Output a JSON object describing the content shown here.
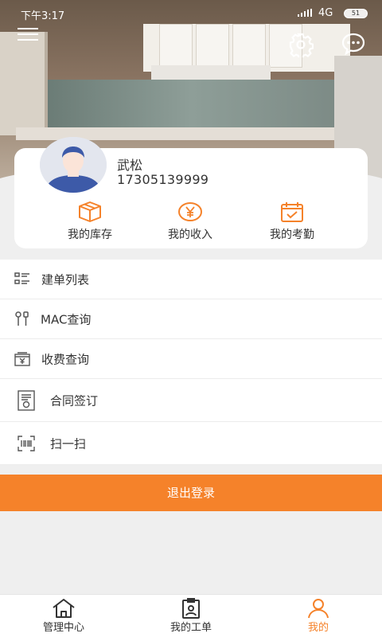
{
  "status_bar": {
    "time": "下午3:17",
    "network": "4G",
    "battery": "51"
  },
  "header": {
    "menu_icon": "menu-icon",
    "settings_icon": "gear-icon",
    "message_icon": "chat-bubble-icon"
  },
  "profile": {
    "name": "武松",
    "phone": "17305139999",
    "quick_links": [
      {
        "label": "我的库存",
        "icon": "box-icon"
      },
      {
        "label": "我的收入",
        "icon": "yen-coin-icon"
      },
      {
        "label": "我的考勤",
        "icon": "calendar-check-icon"
      }
    ]
  },
  "menu_items": [
    {
      "label": "建单列表",
      "icon": "list-icon"
    },
    {
      "label": "MAC查询",
      "icon": "tools-icon"
    },
    {
      "label": "收费查询",
      "icon": "fee-box-icon"
    },
    {
      "label": "合同签订",
      "icon": "contract-icon"
    },
    {
      "label": "扫一扫",
      "icon": "barcode-scan-icon"
    }
  ],
  "logout_label": "退出登录",
  "tabs": [
    {
      "label": "管理中心",
      "icon": "home-icon",
      "active": false
    },
    {
      "label": "我的工单",
      "icon": "work-order-icon",
      "active": false
    },
    {
      "label": "我的",
      "icon": "person-icon",
      "active": true
    }
  ],
  "colors": {
    "accent": "#f5822a",
    "background": "#efefef"
  }
}
